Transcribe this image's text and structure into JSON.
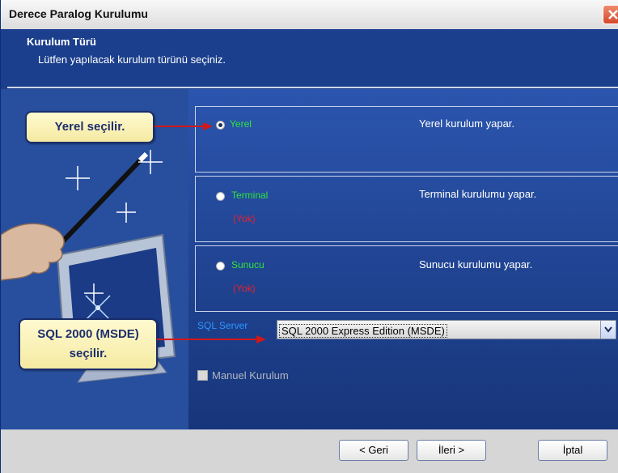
{
  "window": {
    "title": "Derece Paralog Kurulumu"
  },
  "header": {
    "title": "Kurulum Türü",
    "subtitle": "Lütfen yapılacak kurulum türünü seçiniz."
  },
  "options": [
    {
      "label": "Yerel",
      "yok": "",
      "description": "Yerel kurulum yapar.",
      "checked": true
    },
    {
      "label": "Terminal",
      "yok": "(Yok)",
      "description": "Terminal kurulumu yapar.",
      "checked": false
    },
    {
      "label": "Sunucu",
      "yok": "(Yok)",
      "description": "Sunucu kurulumu yapar.",
      "checked": false
    }
  ],
  "sql": {
    "label": "SQL Server",
    "selected": "SQL 2000 Express Edition (MSDE)"
  },
  "manual": {
    "label": "Manuel Kurulum",
    "checked": false
  },
  "buttons": {
    "back": "< Geri",
    "next": "İleri >",
    "cancel": "İptal"
  },
  "callouts": {
    "yerel": "Yerel seçilir.",
    "sql_line1": "SQL 2000 (MSDE)",
    "sql_line2": "seçilir."
  },
  "colors": {
    "header": "#1b3f8c",
    "option_label": "#2ee33e",
    "yok": "#e8202a",
    "sql_label": "#2b96ff",
    "callout_bg": "#fffad0"
  }
}
